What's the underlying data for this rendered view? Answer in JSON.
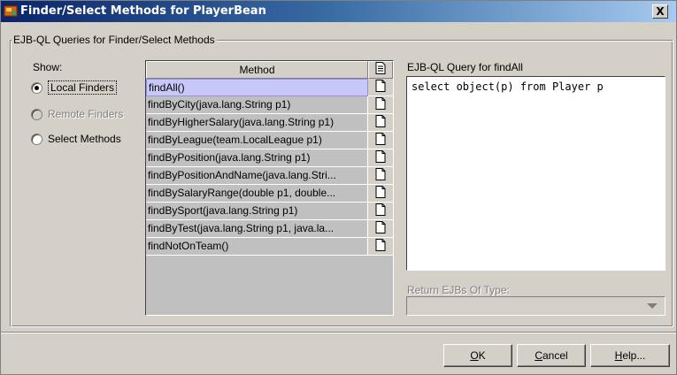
{
  "window": {
    "title": "Finder/Select Methods for PlayerBean",
    "close_label": "X"
  },
  "group": {
    "title": "EJB-QL Queries for Finder/Select Methods"
  },
  "show": {
    "label": "Show:",
    "options": [
      {
        "label": "Local Finders",
        "checked": true,
        "enabled": true
      },
      {
        "label": "Remote Finders",
        "checked": false,
        "enabled": false
      },
      {
        "label": "Select Methods",
        "checked": false,
        "enabled": true
      }
    ]
  },
  "table": {
    "header_method": "Method",
    "rows": [
      "findAll()",
      "findByCity(java.lang.String p1)",
      "findByHigherSalary(java.lang.String p1)",
      "findByLeague(team.LocalLeague p1)",
      "findByPosition(java.lang.String p1)",
      "findByPositionAndName(java.lang.Stri...",
      "findBySalaryRange(double p1, double...",
      "findBySport(java.lang.String p1)",
      "findByTest(java.lang.String p1, java.la...",
      "findNotOnTeam()"
    ],
    "selected_index": 0
  },
  "query": {
    "label": "EJB-QL Query for findAll",
    "text": "select object(p) from Player p"
  },
  "return_type": {
    "label": "Return EJBs Of Type:",
    "value": ""
  },
  "buttons": {
    "ok_mnemonic": "O",
    "ok_rest": "K",
    "cancel_mnemonic": "C",
    "cancel_rest": "ancel",
    "help_mnemonic": "H",
    "help_rest": "elp..."
  }
}
